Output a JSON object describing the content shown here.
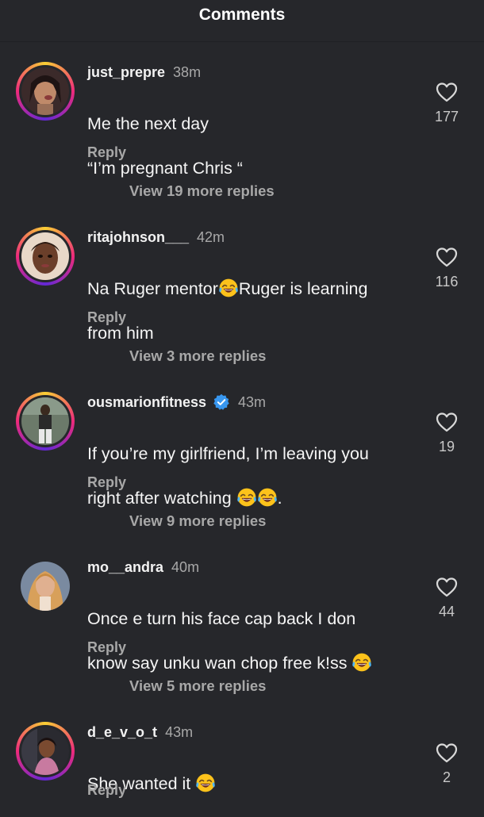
{
  "header": {
    "title": "Comments"
  },
  "comments": [
    {
      "username": "just_prepre",
      "time": "38m",
      "text_1": "Me the next day",
      "text_2": "“I’m pregnant Chris “",
      "reply": "Reply",
      "view_replies": "View 19 more replies",
      "likes": "177",
      "verified": false
    },
    {
      "username": "ritajohnson___",
      "time": "42m",
      "text_a": "Na Ruger mentor",
      "text_b": "Ruger is learning",
      "text_c": "from him",
      "reply": "Reply",
      "view_replies": "View 3 more replies",
      "likes": "116",
      "verified": false
    },
    {
      "username": "ousmarionfitness",
      "time": "43m",
      "text_a": "If you’re my girlfriend, I’m leaving you",
      "text_b": "right after watching",
      "text_c": ".",
      "reply": "Reply",
      "view_replies": "View 9 more replies",
      "likes": "19",
      "verified": true
    },
    {
      "username": "mo__andra",
      "time": "40m",
      "text_a": "Once e turn his face cap back I don",
      "text_b": "know say unku wan chop free k!ss",
      "reply": "Reply",
      "view_replies": "View 5 more replies",
      "likes": "44",
      "verified": false
    },
    {
      "username": "d_e_v_o_t",
      "time": "43m",
      "text_a": "She wanted it",
      "reply": "Reply",
      "likes": "2",
      "verified": false
    }
  ],
  "icons": {
    "heart": "heart-outline-icon",
    "verified": "verified-badge-icon",
    "emoji": "face-with-tears-of-joy-emoji"
  },
  "colors": {
    "background": "#26272b",
    "secondary_text": "#a8a8a8",
    "verified_blue": "#3897f0"
  }
}
